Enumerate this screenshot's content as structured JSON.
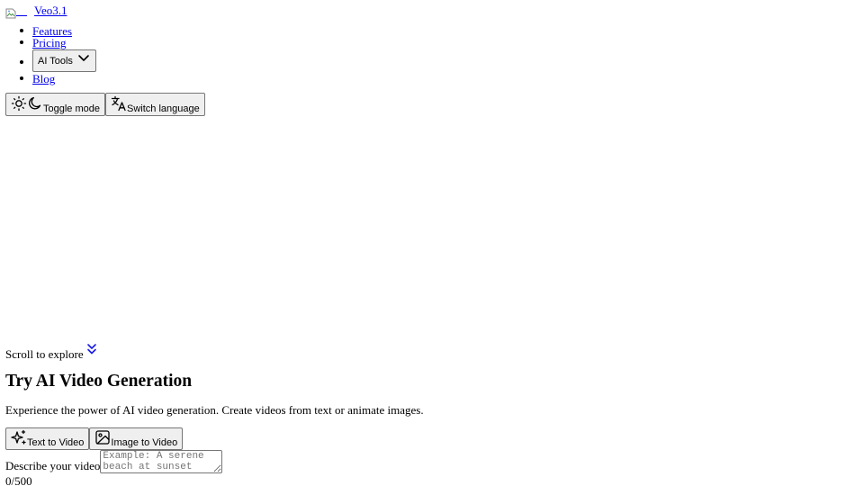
{
  "header": {
    "brand_name": "Veo3.1",
    "nav": [
      {
        "label": "Features"
      },
      {
        "label": "Pricing"
      },
      {
        "label": "AI Tools"
      },
      {
        "label": "Blog"
      }
    ],
    "toggle_mode_label": "Toggle mode",
    "switch_language_label": "Switch language"
  },
  "hero": {
    "scroll_hint": "Scroll to explore"
  },
  "generator": {
    "title": "Try AI Video Generation",
    "description": "Experience the power of AI video generation. Create videos from text or animate images.",
    "tabs": [
      {
        "label": "Text to Video"
      },
      {
        "label": "Image to Video"
      }
    ],
    "prompt_label": "Describe your video",
    "prompt_placeholder": "Example: A serene beach at sunset with",
    "char_count": "0/500"
  },
  "colors": {
    "link": "#0000ee",
    "accent_icon": "#0000ee",
    "button_bg": "#efefef",
    "button_border": "#767676"
  },
  "icons": {
    "logo": "broken-image-icon",
    "tools_chevron": "chevron-down-icon",
    "theme_sun": "sun-icon",
    "theme_moon": "moon-icon",
    "language": "translate-icon",
    "scroll": "double-chevron-down-icon",
    "text_to_video": "sparkles-icon",
    "image_to_video": "image-icon"
  }
}
